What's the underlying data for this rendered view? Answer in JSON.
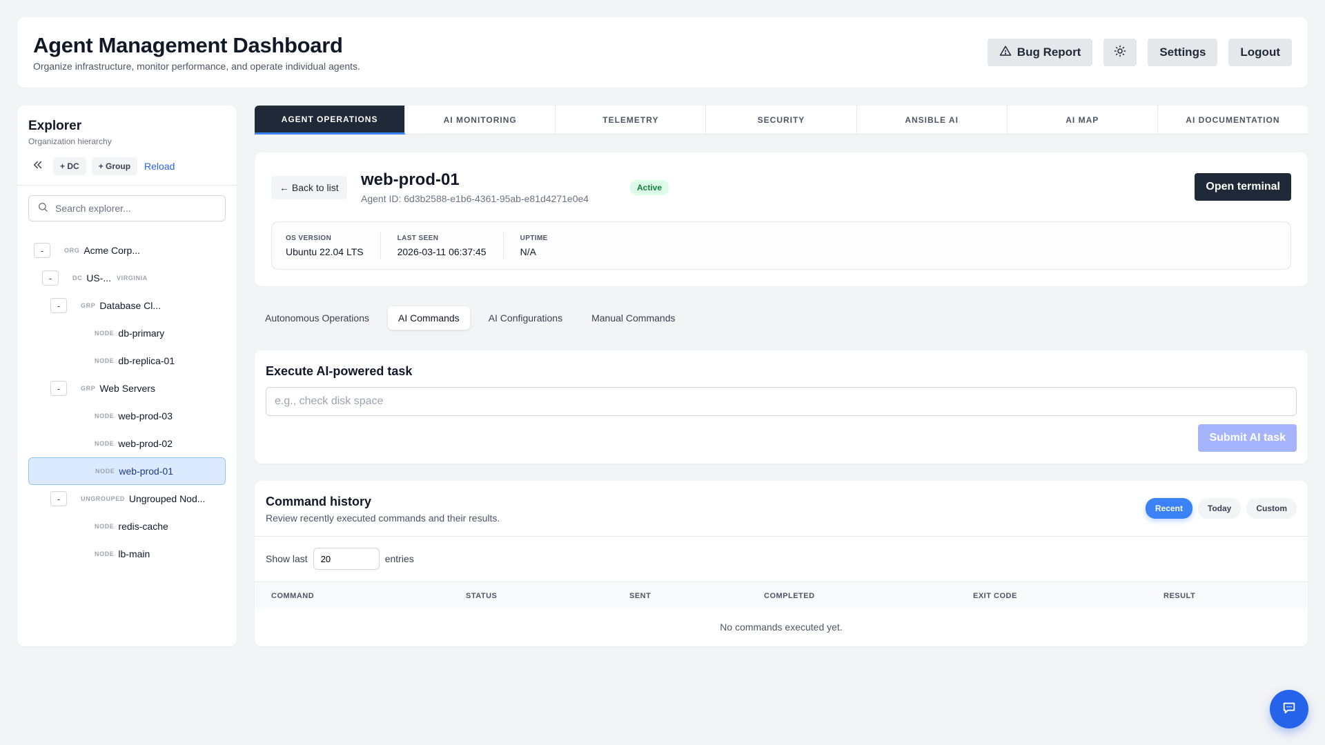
{
  "header": {
    "title": "Agent Management Dashboard",
    "subtitle": "Organize infrastructure, monitor performance, and operate individual agents.",
    "bug_report_label": "Bug Report",
    "settings_label": "Settings",
    "logout_label": "Logout"
  },
  "sidebar": {
    "title": "Explorer",
    "subtitle": "Organization hierarchy",
    "add_dc_label": "+ DC",
    "add_group_label": "+ Group",
    "reload_label": "Reload",
    "search_placeholder": "Search explorer...",
    "tree": [
      {
        "type": "ORG",
        "label": "Acme Corp...",
        "sub": "",
        "toggle": "-"
      },
      {
        "type": "DC",
        "label": "US-...",
        "sub": "VIRGINIA",
        "toggle": "-"
      },
      {
        "type": "GRP",
        "label": "Database Cl...",
        "sub": "",
        "toggle": "-"
      },
      {
        "type": "NODE",
        "label": "db-primary",
        "sub": "",
        "toggle": ""
      },
      {
        "type": "NODE",
        "label": "db-replica-01",
        "sub": "",
        "toggle": ""
      },
      {
        "type": "GRP",
        "label": "Web Servers",
        "sub": "",
        "toggle": "-"
      },
      {
        "type": "NODE",
        "label": "web-prod-03",
        "sub": "",
        "toggle": ""
      },
      {
        "type": "NODE",
        "label": "web-prod-02",
        "sub": "",
        "toggle": ""
      },
      {
        "type": "NODE",
        "label": "web-prod-01",
        "sub": "",
        "toggle": ""
      },
      {
        "type": "UNGROUPED",
        "label": "Ungrouped Nod...",
        "sub": "",
        "toggle": "-"
      },
      {
        "type": "NODE",
        "label": "redis-cache",
        "sub": "",
        "toggle": ""
      },
      {
        "type": "NODE",
        "label": "lb-main",
        "sub": "",
        "toggle": ""
      }
    ]
  },
  "main_tabs": [
    {
      "label": "AGENT OPERATIONS",
      "active": true
    },
    {
      "label": "AI MONITORING",
      "active": false
    },
    {
      "label": "TELEMETRY",
      "active": false
    },
    {
      "label": "SECURITY",
      "active": false
    },
    {
      "label": "ANSIBLE AI",
      "active": false
    },
    {
      "label": "AI MAP",
      "active": false
    },
    {
      "label": "AI DOCUMENTATION",
      "active": false
    }
  ],
  "agent": {
    "back_label": "← Back to list",
    "name": "web-prod-01",
    "id_text": "Agent ID: 6d3b2588-e1b6-4361-95ab-e81d4271e0e4",
    "status": "Active",
    "open_terminal_label": "Open terminal",
    "stats": [
      {
        "label": "OS VERSION",
        "value": "Ubuntu 22.04 LTS"
      },
      {
        "label": "LAST SEEN",
        "value": "2026-03-11 06:37:45"
      },
      {
        "label": "UPTIME",
        "value": "N/A"
      }
    ]
  },
  "sub_tabs": [
    {
      "label": "Autonomous Operations",
      "active": false
    },
    {
      "label": "AI Commands",
      "active": true
    },
    {
      "label": "AI Configurations",
      "active": false
    },
    {
      "label": "Manual Commands",
      "active": false
    }
  ],
  "execute": {
    "title": "Execute AI-powered task",
    "placeholder": "e.g., check disk space",
    "submit_label": "Submit AI task"
  },
  "history": {
    "title": "Command history",
    "subtitle": "Review recently executed commands and their results.",
    "filters": [
      {
        "label": "Recent",
        "active": true
      },
      {
        "label": "Today",
        "active": false
      },
      {
        "label": "Custom",
        "active": false
      }
    ],
    "show_last_label": "Show last",
    "show_last_value": "20",
    "entries_label": "entries",
    "columns": [
      "COMMAND",
      "STATUS",
      "SENT",
      "COMPLETED",
      "EXIT CODE",
      "RESULT"
    ],
    "empty_text": "No commands executed yet."
  },
  "colors": {
    "accent": "#3b82f6",
    "dark": "#1f2937",
    "active_badge_bg": "#dcfce7",
    "active_badge_text": "#15803d"
  },
  "icons": [
    "warning-triangle-icon",
    "sun-icon",
    "double-chevron-left-icon",
    "search-icon",
    "chat-icon"
  ]
}
